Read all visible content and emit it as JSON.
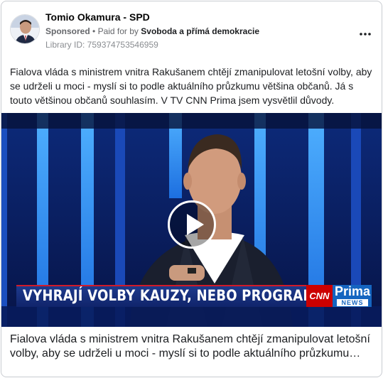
{
  "ad": {
    "page_name": "Tomio Okamura - SPD",
    "sponsored_label": "Sponsored",
    "paid_for_prefix": "Paid for by",
    "payer": "Svoboda a přímá demokracie",
    "library_id": "Library ID: 759374753546959",
    "more_icon": "more-horizontal-icon",
    "body_lines": [
      "Fialova vláda s ministrem vnitra Rakušanem chtějí zmanipulovat letošní volby, aby",
      "se udrželi u moci - myslí si to podle aktuálního průzkumu většina občanů. Já s",
      "touto většinou občanů souhlasím. V TV CNN Prima jsem vysvětlil důvody."
    ]
  },
  "video": {
    "play_icon": "play-icon",
    "banner_text": "VYHRAJÍ VOLBY KAUZY, NEBO PROGRAM?",
    "channel_logo_1": "CNN",
    "channel_logo_2": "Prima",
    "channel_logo_3": "NEWS"
  },
  "caption": {
    "line1": "Fialova vláda s ministrem vnitra Rakušanem chtějí zmanipulovat letošní",
    "line2": "volby, aby se udrželi u moci - myslí si to podle aktuálního průzkumu…"
  },
  "colors": {
    "text": "#1c1e21",
    "secondary": "#65676b",
    "border": "#c9ccd1",
    "studio_blue": "#0a1a4a",
    "banner_blue": "#1e3a8c",
    "cnn_red": "#cc0000",
    "prima_blue": "#1565c0"
  }
}
